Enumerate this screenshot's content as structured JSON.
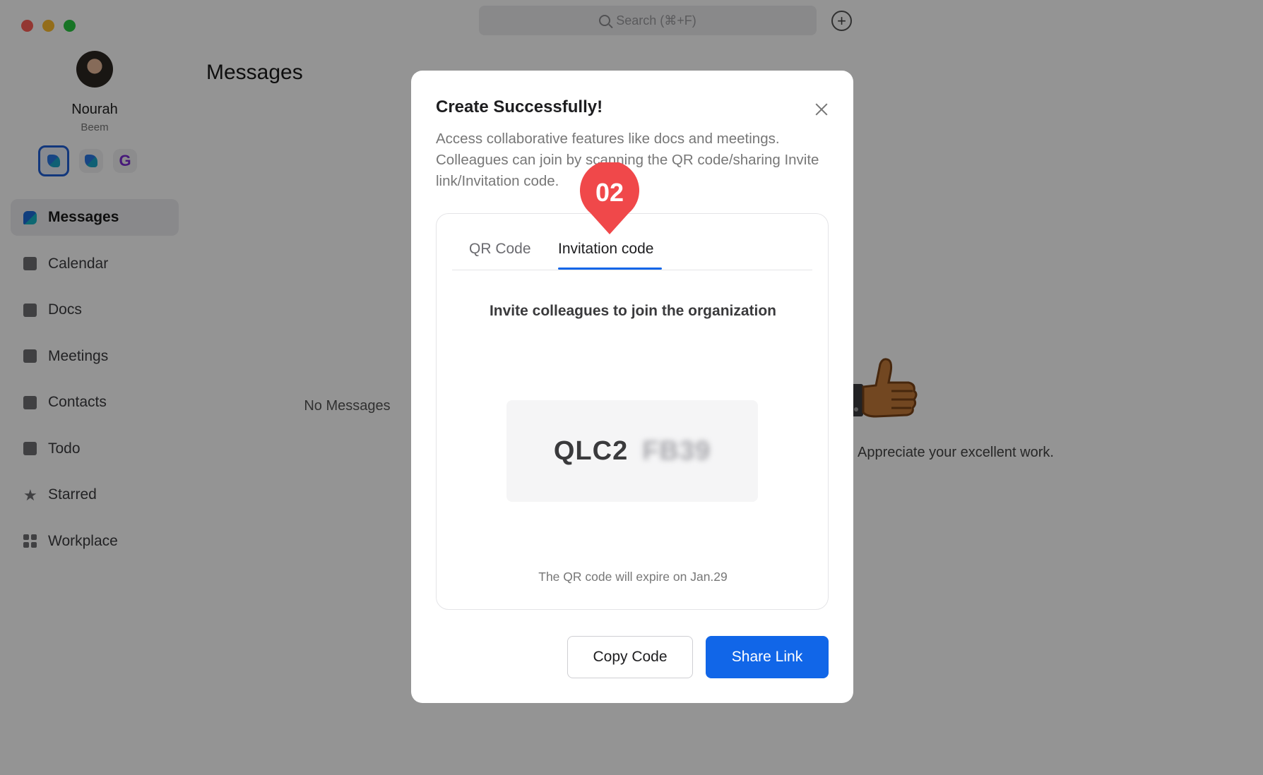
{
  "search": {
    "placeholder": "Search (⌘+F)"
  },
  "profile": {
    "name": "Nourah",
    "org": "Beem"
  },
  "sidebar": {
    "items": [
      {
        "label": "Messages",
        "icon": "messages-icon"
      },
      {
        "label": "Calendar",
        "icon": "calendar-icon"
      },
      {
        "label": "Docs",
        "icon": "docs-icon"
      },
      {
        "label": "Meetings",
        "icon": "meetings-icon"
      },
      {
        "label": "Contacts",
        "icon": "contacts-icon"
      },
      {
        "label": "Todo",
        "icon": "todo-icon"
      },
      {
        "label": "Starred",
        "icon": "star-icon"
      },
      {
        "label": "Workplace",
        "icon": "workplace-icon"
      }
    ]
  },
  "messages": {
    "title": "Messages",
    "empty": "No Messages"
  },
  "right_panel": {
    "text": "Appreciate your excellent work."
  },
  "modal": {
    "title": "Create Successfully!",
    "description": "Access collaborative features like docs and meetings. Colleagues can join by scanning the QR code/sharing Invite link/Invitation code.",
    "tabs": [
      "QR Code",
      "Invitation code"
    ],
    "active_tab": "Invitation code",
    "invite_heading": "Invite colleagues to join the organization",
    "code_visible": "QLC2",
    "code_hidden": "FB39",
    "expire_text": "The QR code will expire on Jan.29",
    "copy_button": "Copy Code",
    "share_button": "Share Link"
  },
  "step_marker": {
    "label": "02",
    "color": "#f0484a"
  },
  "colors": {
    "accent": "#1166e8"
  }
}
